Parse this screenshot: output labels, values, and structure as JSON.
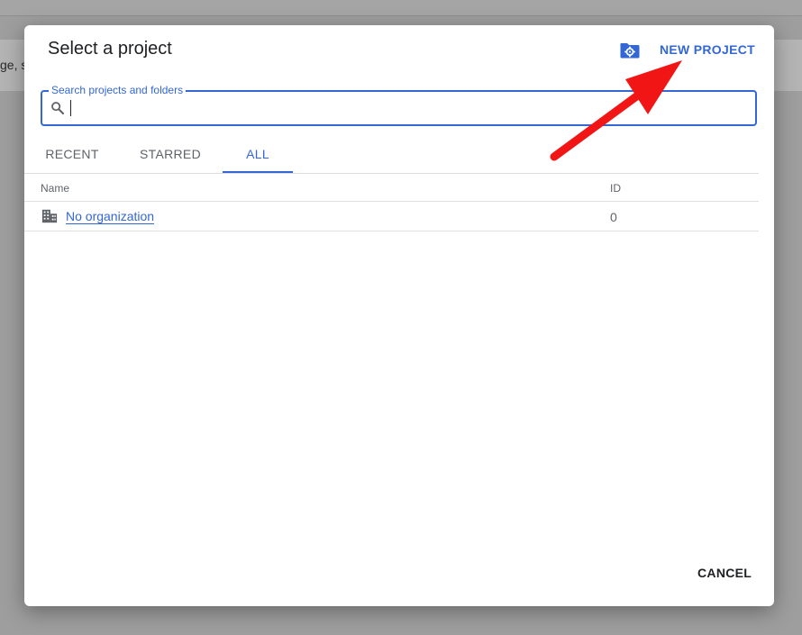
{
  "background": {
    "snippet": "ge, s"
  },
  "dialog": {
    "title": "Select a project",
    "new_project_label": "NEW PROJECT",
    "folder_icon": "folder-settings-icon",
    "search": {
      "label": "Search projects and folders",
      "value": "",
      "icon": "search-icon"
    },
    "tabs": [
      {
        "label": "RECENT",
        "active": false
      },
      {
        "label": "STARRED",
        "active": false
      },
      {
        "label": "ALL",
        "active": true
      }
    ],
    "table": {
      "columns": [
        "Name",
        "ID"
      ],
      "rows": [
        {
          "icon": "building-icon",
          "name": "No organization",
          "id": "0"
        }
      ]
    },
    "cancel_label": "CANCEL"
  },
  "colors": {
    "accent": "#3367d6",
    "arrow": "#f21515"
  }
}
